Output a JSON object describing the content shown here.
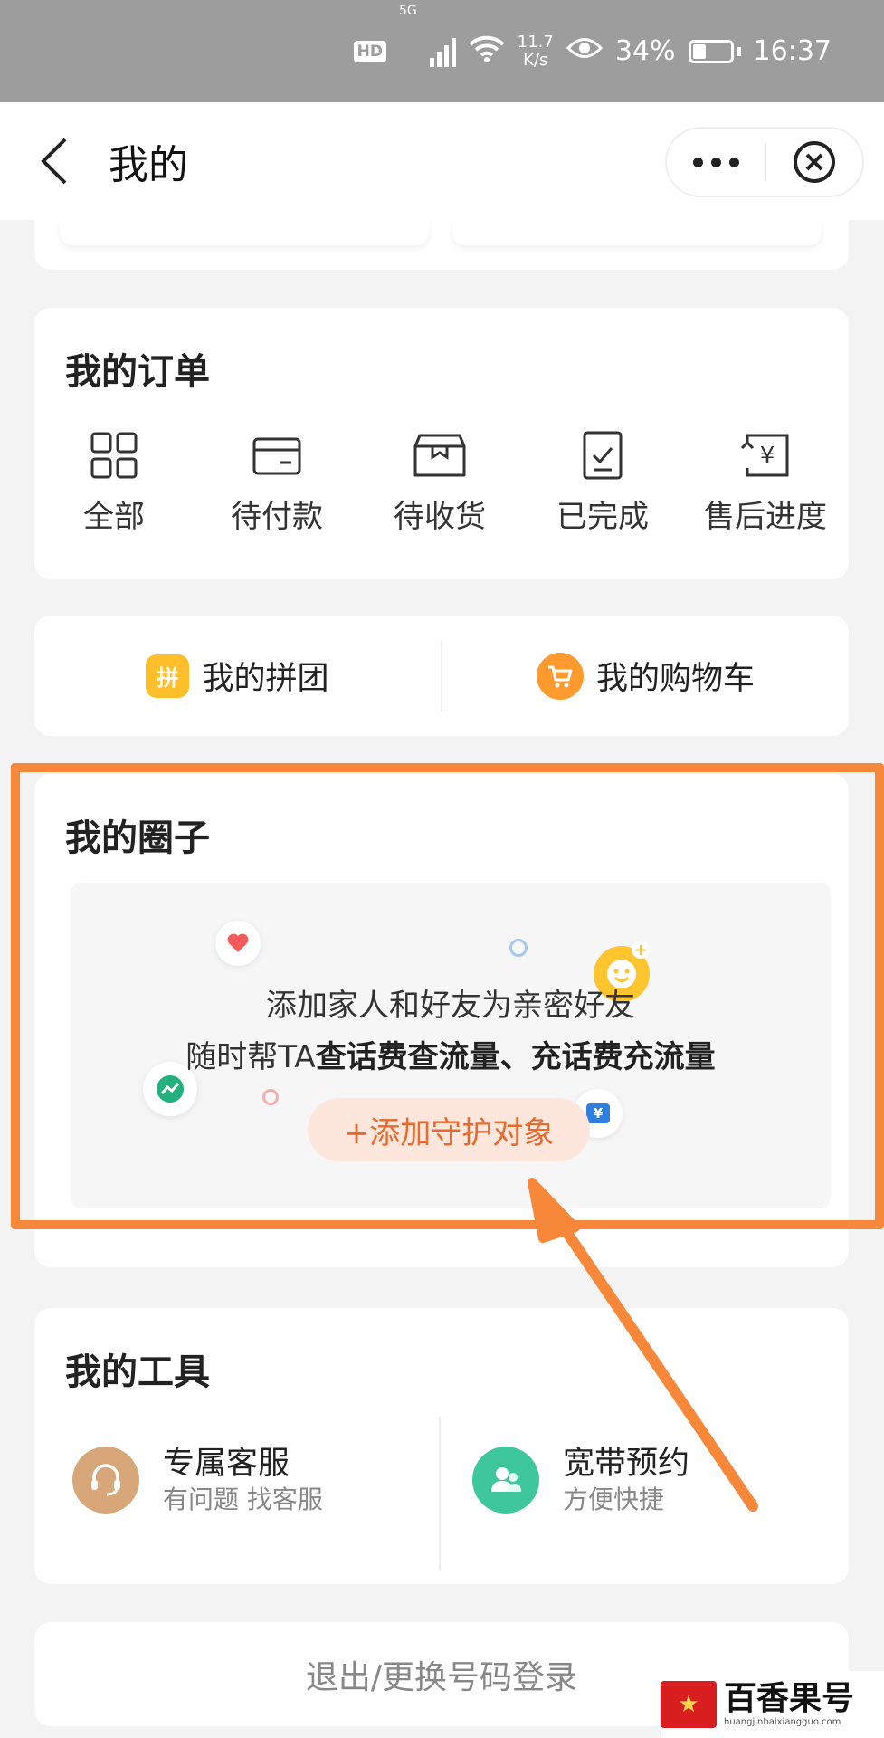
{
  "status_bar": {
    "hd": "HD",
    "network": "5G",
    "speed_value": "11.7",
    "speed_unit": "K/s",
    "battery_percent": "34%",
    "time": "16:37"
  },
  "header": {
    "title": "我的"
  },
  "orders": {
    "title": "我的订单",
    "items": [
      {
        "label": "全部",
        "icon": "grid-icon"
      },
      {
        "label": "待付款",
        "icon": "wallet-icon"
      },
      {
        "label": "待收货",
        "icon": "box-icon"
      },
      {
        "label": "已完成",
        "icon": "checklist-icon"
      },
      {
        "label": "售后进度",
        "icon": "refund-icon"
      }
    ]
  },
  "shortcuts": {
    "group_buy": {
      "label": "我的拼团",
      "icon_glyph": "拼"
    },
    "cart": {
      "label": "我的购物车"
    }
  },
  "circle": {
    "title": "我的圈子",
    "line1": "添加家人和好友为亲密好友",
    "line2_prefix": "随时帮TA",
    "line2_bold": "查话费查流量、充话费充流量",
    "add_button": "+添加守护对象",
    "ticket_glyph": "¥"
  },
  "tools": {
    "title": "我的工具",
    "items": [
      {
        "name": "专属客服",
        "sub": "有问题 找客服",
        "icon": "headset-icon"
      },
      {
        "name": "宽带预约",
        "sub": "方便快捷",
        "icon": "broadband-icon"
      }
    ]
  },
  "logout": {
    "label": "退出/更换号码登录"
  },
  "watermark": {
    "cn": "百香果号",
    "url": "huangjinbaixiangguo.com"
  },
  "colors": {
    "accent_orange": "#f7883a",
    "button_text": "#e86a2e",
    "button_bg": "#fde7dc"
  }
}
